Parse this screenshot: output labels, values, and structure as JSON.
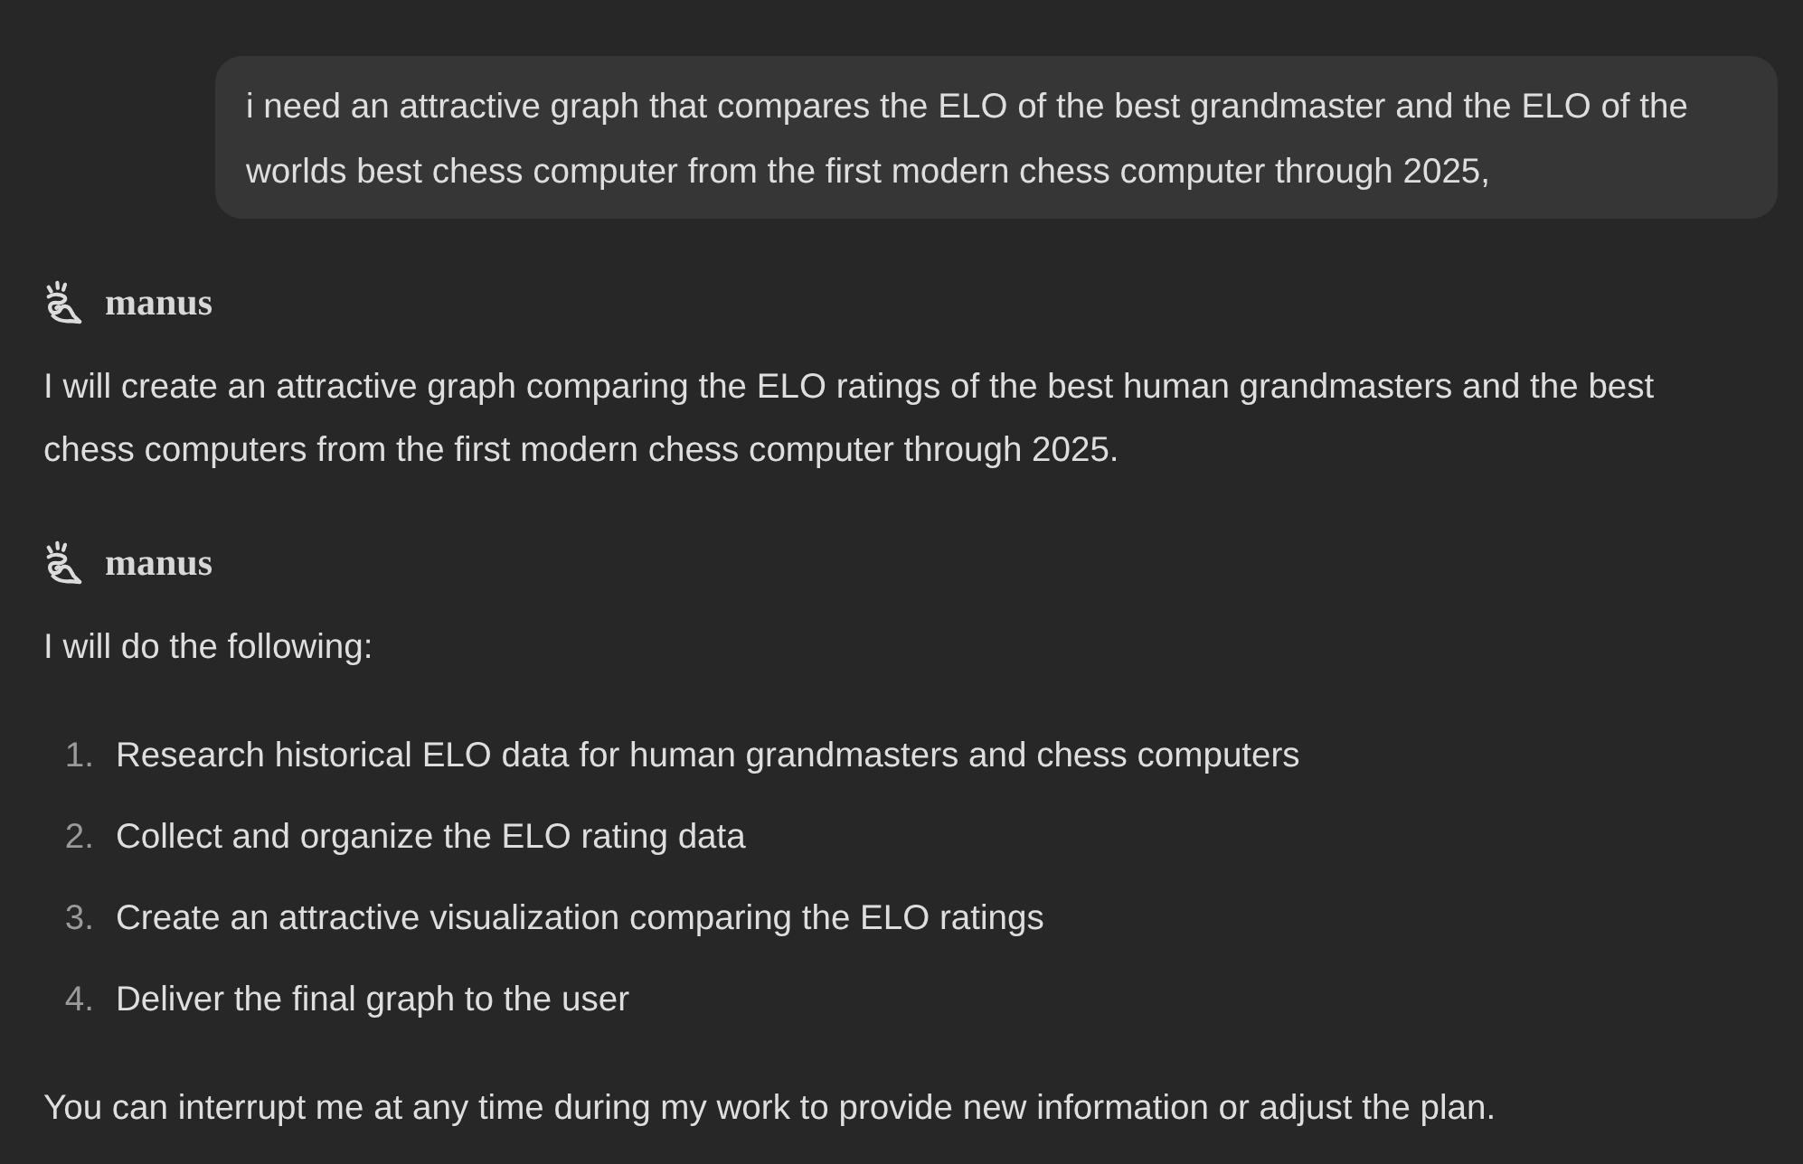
{
  "messages": [
    {
      "kind": "user",
      "text": "i need an attractive graph that compares the ELO of the best grandmaster and the ELO of the worlds best chess computer from the first modern chess computer through 2025,"
    },
    {
      "kind": "assistant",
      "sender": "manus",
      "blocks": [
        {
          "kind": "paragraph",
          "text": "I will create an attractive graph comparing the ELO ratings of the best human grandmasters and the best chess computers from the first modern chess computer through 2025."
        }
      ]
    },
    {
      "kind": "assistant",
      "sender": "manus",
      "blocks": [
        {
          "kind": "paragraph",
          "text": "I will do the following:"
        },
        {
          "kind": "ordered_list",
          "items": [
            {
              "number": "1.",
              "text": "Research historical ELO data for human grandmasters and chess computers"
            },
            {
              "number": "2.",
              "text": "Collect and organize the ELO rating data"
            },
            {
              "number": "3.",
              "text": "Create an attractive visualization comparing the ELO ratings"
            },
            {
              "number": "4.",
              "text": "Deliver the final graph to the user"
            }
          ]
        },
        {
          "kind": "paragraph",
          "text": "You can interrupt me at any time during my work to provide new information or adjust the plan."
        }
      ]
    }
  ]
}
